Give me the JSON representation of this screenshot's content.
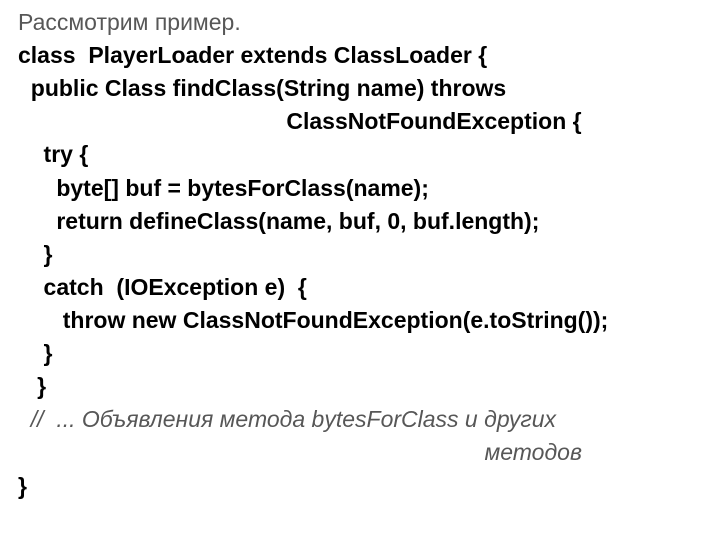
{
  "intro": "Рассмотрим пример.",
  "code": {
    "l1": "class  PlayerLoader extends ClassLoader {",
    "l2": "  public Class findClass(String name) throws",
    "l3": "                                          ClassNotFoundException {",
    "l4": "    try {",
    "l5": "      byte[] buf = bytesForClass(name);",
    "l6": "      return defineClass(name, buf, 0, buf.length);",
    "l7": "    }",
    "l8": "    catch  (IOException e)  {",
    "l9": "       throw new ClassNotFoundException(e.toString());",
    "l10": "    }",
    "l11": "   }",
    "comment1": "  //  ... Объявления метода bytesForClass и других",
    "comment2": "                                                                         методов",
    "l12": "}"
  }
}
